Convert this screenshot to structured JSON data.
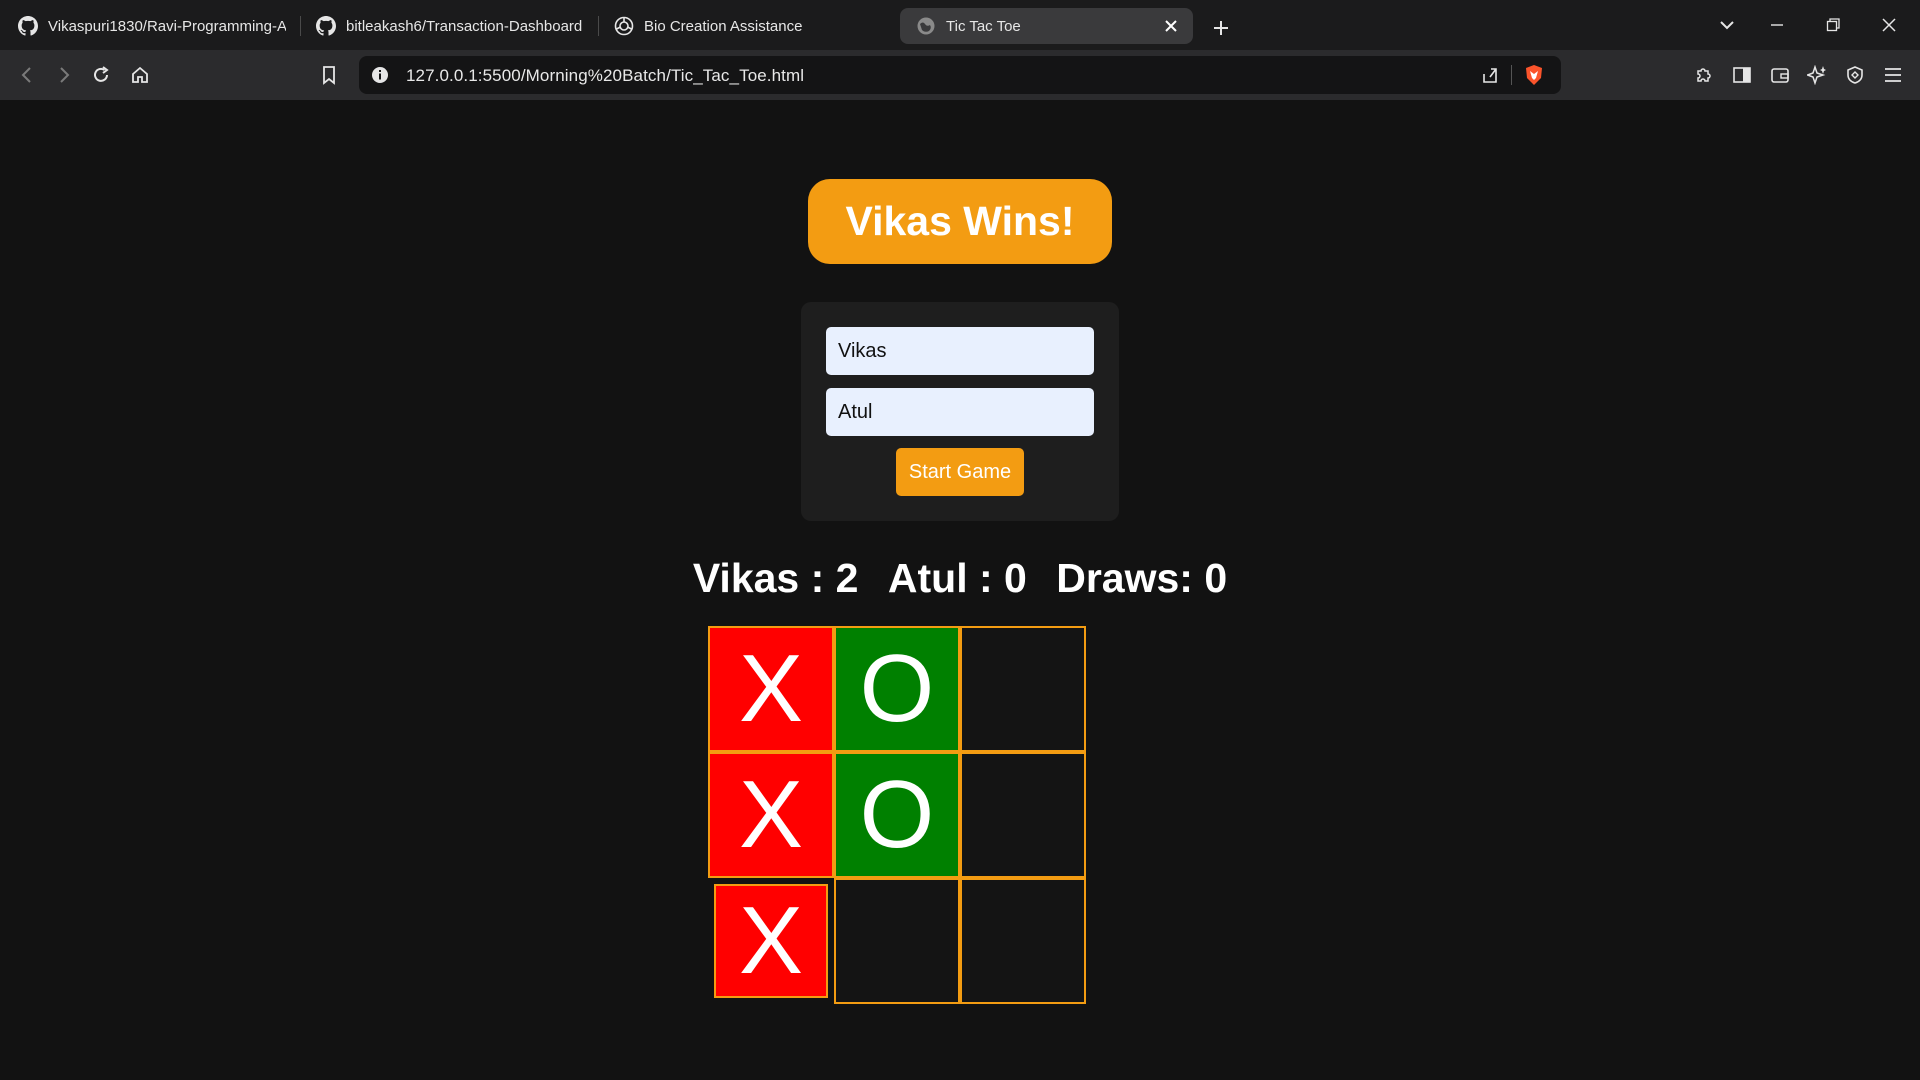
{
  "browser": {
    "tabs": [
      {
        "title": "Vikaspuri1830/Ravi-Programming-A",
        "icon": "github-icon"
      },
      {
        "title": "bitleakash6/Transaction-Dashboard",
        "icon": "github-icon"
      },
      {
        "title": "Bio Creation Assistance",
        "icon": "openai-icon"
      },
      {
        "title": "Tic Tac Toe",
        "icon": "globe-icon"
      }
    ],
    "url": "127.0.0.1:5500/Morning%20Batch/Tic_Tac_Toe.html"
  },
  "game": {
    "winner_text": "Vikas Wins!",
    "player1_value": "Vikas",
    "player2_value": "Atul",
    "start_label": "Start Game",
    "score": {
      "player1": "Vikas : 2",
      "player2": "Atul : 0",
      "draws": "Draws: 0"
    },
    "board": [
      "X",
      "O",
      "",
      "X",
      "O",
      "",
      "X",
      "",
      ""
    ]
  },
  "colors": {
    "accent": "#f39c12",
    "x_cell": "#ff0000",
    "o_cell": "#008000",
    "background": "#121212"
  }
}
